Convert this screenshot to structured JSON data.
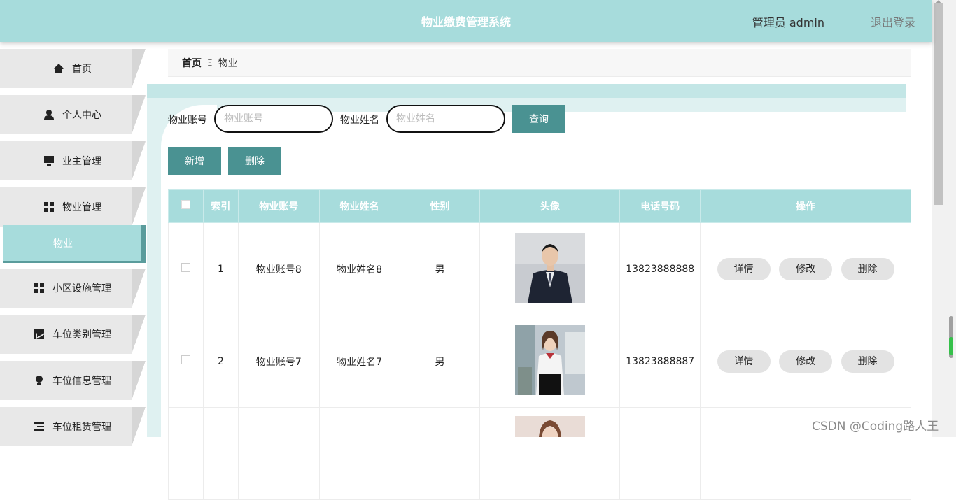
{
  "header": {
    "title": "物业缴费管理系统",
    "user_label": "管理员 admin",
    "logout_label": "退出登录"
  },
  "sidebar": {
    "items": [
      {
        "label": "首页",
        "icon": "home-icon"
      },
      {
        "label": "个人中心",
        "icon": "user-icon"
      },
      {
        "label": "业主管理",
        "icon": "monitor-icon"
      },
      {
        "label": "物业管理",
        "icon": "grid-icon"
      },
      {
        "label": "小区设施管理",
        "icon": "grid-icon"
      },
      {
        "label": "车位类别管理",
        "icon": "chart-icon"
      },
      {
        "label": "车位信息管理",
        "icon": "bulb-icon"
      },
      {
        "label": "车位租赁管理",
        "icon": "list-icon"
      }
    ],
    "active_sub": "物业"
  },
  "breadcrumb": {
    "home": "首页",
    "separator": "Ξ",
    "current": "物业"
  },
  "search": {
    "account_label": "物业账号",
    "account_placeholder": "物业账号",
    "name_label": "物业姓名",
    "name_placeholder": "物业姓名",
    "query_button": "查询"
  },
  "actions": {
    "add": "新增",
    "delete": "删除"
  },
  "table": {
    "headers": [
      "索引",
      "物业账号",
      "物业姓名",
      "性别",
      "头像",
      "电话号码",
      "操作"
    ],
    "rows": [
      {
        "index": "1",
        "account": "物业账号8",
        "name": "物业姓名8",
        "gender": "男",
        "phone": "13823888888"
      },
      {
        "index": "2",
        "account": "物业账号7",
        "name": "物业姓名7",
        "gender": "男",
        "phone": "13823888887"
      },
      {
        "index": "",
        "account": "",
        "name": "",
        "gender": "",
        "phone": ""
      }
    ],
    "op_buttons": {
      "detail": "详情",
      "edit": "修改",
      "delete": "删除"
    }
  },
  "watermark": "CSDN @Coding路人王",
  "colors": {
    "primary": "#a7dcdc",
    "button": "#4a9292",
    "band_dark": "#c3e6e6",
    "band_light": "#dff1f1"
  }
}
